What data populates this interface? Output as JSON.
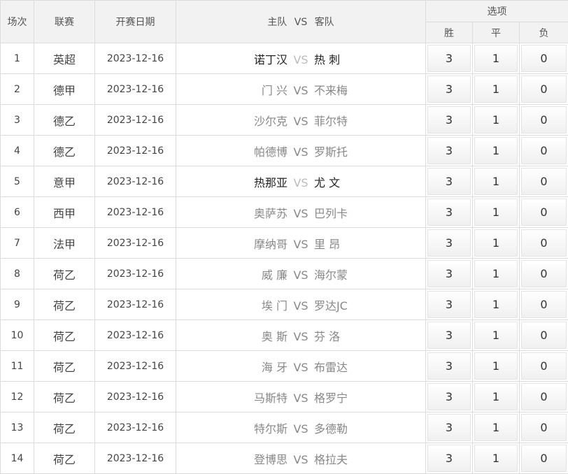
{
  "header": {
    "col_index": "场次",
    "col_league": "联赛",
    "col_date": "开赛日期",
    "col_match_home": "主队",
    "col_match_vs": "VS",
    "col_match_away": "客队",
    "col_options": "选项",
    "opt_win": "胜",
    "opt_draw": "平",
    "opt_lose": "负"
  },
  "rows": [
    {
      "index": "1",
      "league": "英超",
      "date": "2023-12-16",
      "home": "诺丁汉",
      "vs": "VS",
      "away": "热 刺",
      "win": "3",
      "draw": "1",
      "lose": "0",
      "style": "bold"
    },
    {
      "index": "2",
      "league": "德甲",
      "date": "2023-12-16",
      "home": "门 兴",
      "vs": "VS",
      "away": "不来梅",
      "win": "3",
      "draw": "1",
      "lose": "0",
      "style": "faded"
    },
    {
      "index": "3",
      "league": "德乙",
      "date": "2023-12-16",
      "home": "沙尔克",
      "vs": "VS",
      "away": "菲尔特",
      "win": "3",
      "draw": "1",
      "lose": "0",
      "style": "faded"
    },
    {
      "index": "4",
      "league": "德乙",
      "date": "2023-12-16",
      "home": "帕德博",
      "vs": "VS",
      "away": "罗斯托",
      "win": "3",
      "draw": "1",
      "lose": "0",
      "style": "faded"
    },
    {
      "index": "5",
      "league": "意甲",
      "date": "2023-12-16",
      "home": "热那亚",
      "vs": "VS",
      "away": "尤 文",
      "win": "3",
      "draw": "1",
      "lose": "0",
      "style": "bold"
    },
    {
      "index": "6",
      "league": "西甲",
      "date": "2023-12-16",
      "home": "奥萨苏",
      "vs": "VS",
      "away": "巴列卡",
      "win": "3",
      "draw": "1",
      "lose": "0",
      "style": "faded"
    },
    {
      "index": "7",
      "league": "法甲",
      "date": "2023-12-16",
      "home": "摩纳哥",
      "vs": "VS",
      "away": "里 昂",
      "win": "3",
      "draw": "1",
      "lose": "0",
      "style": "faded"
    },
    {
      "index": "8",
      "league": "荷乙",
      "date": "2023-12-16",
      "home": "威 廉",
      "vs": "VS",
      "away": "海尔蒙",
      "win": "3",
      "draw": "1",
      "lose": "0",
      "style": "faded"
    },
    {
      "index": "9",
      "league": "荷乙",
      "date": "2023-12-16",
      "home": "埃 门",
      "vs": "VS",
      "away": "罗达JC",
      "win": "3",
      "draw": "1",
      "lose": "0",
      "style": "faded"
    },
    {
      "index": "10",
      "league": "荷乙",
      "date": "2023-12-16",
      "home": "奥 斯",
      "vs": "VS",
      "away": "芬 洛",
      "win": "3",
      "draw": "1",
      "lose": "0",
      "style": "faded"
    },
    {
      "index": "11",
      "league": "荷乙",
      "date": "2023-12-16",
      "home": "海 牙",
      "vs": "VS",
      "away": "布雷达",
      "win": "3",
      "draw": "1",
      "lose": "0",
      "style": "faded"
    },
    {
      "index": "12",
      "league": "荷乙",
      "date": "2023-12-16",
      "home": "马斯特",
      "vs": "VS",
      "away": "格罗宁",
      "win": "3",
      "draw": "1",
      "lose": "0",
      "style": "faded"
    },
    {
      "index": "13",
      "league": "荷乙",
      "date": "2023-12-16",
      "home": "特尔斯",
      "vs": "VS",
      "away": "多德勒",
      "win": "3",
      "draw": "1",
      "lose": "0",
      "style": "faded"
    },
    {
      "index": "14",
      "league": "荷乙",
      "date": "2023-12-16",
      "home": "登博思",
      "vs": "VS",
      "away": "格拉夫",
      "win": "3",
      "draw": "1",
      "lose": "0",
      "style": "faded"
    }
  ]
}
